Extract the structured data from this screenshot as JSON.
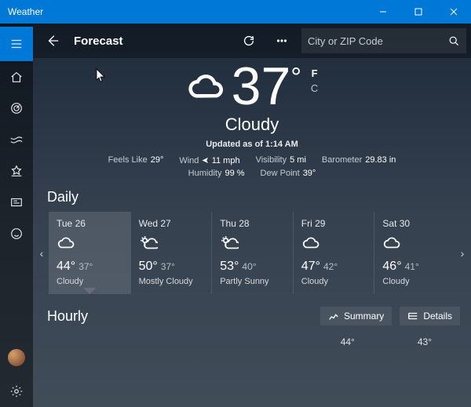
{
  "window": {
    "title": "Weather"
  },
  "toolbar": {
    "heading": "Forecast",
    "search_placeholder": "City or ZIP Code"
  },
  "units": {
    "f": "F",
    "c": "C"
  },
  "current": {
    "temp": "37",
    "condition": "Cloudy",
    "updated": "Updated as of 1:14 AM"
  },
  "stats": {
    "feels_label": "Feels Like",
    "feels_val": "29°",
    "wind_label": "Wind",
    "wind_val": "11 mph",
    "vis_label": "Visibility",
    "vis_val": "5 mi",
    "baro_label": "Barometer",
    "baro_val": "29.83 in",
    "hum_label": "Humidity",
    "hum_val": "99 %",
    "dew_label": "Dew Point",
    "dew_val": "39°"
  },
  "sections": {
    "daily": "Daily",
    "hourly": "Hourly"
  },
  "daily": [
    {
      "date": "Tue 26",
      "hi": "44°",
      "lo": "37°",
      "cond": "Cloudy",
      "icon": "cloud"
    },
    {
      "date": "Wed 27",
      "hi": "50°",
      "lo": "37°",
      "cond": "Mostly Cloudy",
      "icon": "partly"
    },
    {
      "date": "Thu 28",
      "hi": "53°",
      "lo": "40°",
      "cond": "Partly Sunny",
      "icon": "partly"
    },
    {
      "date": "Fri 29",
      "hi": "47°",
      "lo": "42°",
      "cond": "Cloudy",
      "icon": "cloud"
    },
    {
      "date": "Sat 30",
      "hi": "46°",
      "lo": "41°",
      "cond": "Cloudy",
      "icon": "cloud"
    }
  ],
  "hourly_buttons": {
    "summary": "Summary",
    "details": "Details"
  },
  "hourly_preview": {
    "t0": "44°",
    "t1": "43°"
  }
}
